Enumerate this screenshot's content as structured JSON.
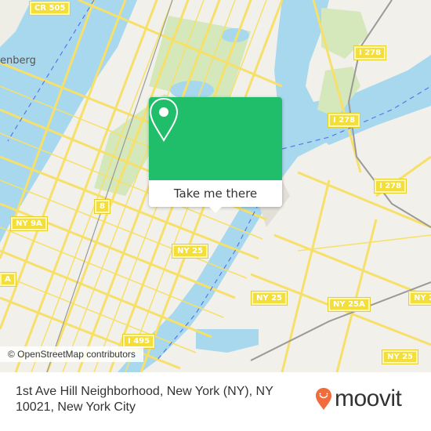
{
  "map": {
    "place_labels": [
      {
        "text": "enberg"
      }
    ],
    "road_shields": [
      {
        "text": "CR 505"
      },
      {
        "text": "I 278"
      },
      {
        "text": "I 278"
      },
      {
        "text": "I 278"
      },
      {
        "text": "8"
      },
      {
        "text": "NY 9A"
      },
      {
        "text": "NY 25"
      },
      {
        "text": "A"
      },
      {
        "text": "NY 25"
      },
      {
        "text": "NY 25A"
      },
      {
        "text": "NY 2"
      },
      {
        "text": "I 495"
      },
      {
        "text": "NY 25"
      }
    ],
    "colors": {
      "water": "#a8d8ee",
      "park": "#d4e8bc",
      "land": "#f2f0eb",
      "road": "#f6e06a",
      "accent": "#20bd6b"
    }
  },
  "popup": {
    "icon": "map-pin-icon",
    "button_label": "Take me there"
  },
  "attribution": "© OpenStreetMap contributors",
  "footer": {
    "address_line1": "1st Ave Hill Neighborhood, New York (NY), NY",
    "address_line2": "10021, New York City",
    "brand": "moovit",
    "brand_color": "#f26b3a"
  }
}
